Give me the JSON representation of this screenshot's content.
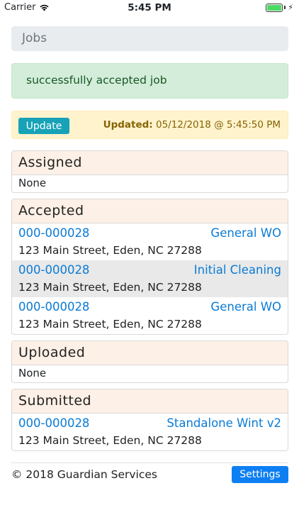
{
  "statusbar": {
    "carrier": "Carrier",
    "time": "5:45 PM"
  },
  "jobs_title": "Jobs",
  "alert": "successfully accepted job",
  "update": {
    "button": "Update",
    "label": "Updated:",
    "value": "05/12/2018 @ 5:45:50 PM"
  },
  "assigned": {
    "title": "Assigned",
    "none": "None"
  },
  "accepted": {
    "title": "Accepted",
    "jobs": [
      {
        "number": "000-000028",
        "type": "General WO",
        "address": "123 Main Street, Eden, NC 27288"
      },
      {
        "number": "000-000028",
        "type": "Initial Cleaning",
        "address": "123 Main Street, Eden, NC 27288"
      },
      {
        "number": "000-000028",
        "type": "General WO",
        "address": "123 Main Street, Eden, NC 27288"
      }
    ]
  },
  "uploaded": {
    "title": "Uploaded",
    "none": "None"
  },
  "submitted": {
    "title": "Submitted",
    "jobs": [
      {
        "number": "000-000028",
        "type": "Standalone Wint v2",
        "address": "123 Main Street, Eden, NC 27288"
      }
    ]
  },
  "footer": {
    "copyright": "© 2018 Guardian Services",
    "settings": "Settings"
  }
}
